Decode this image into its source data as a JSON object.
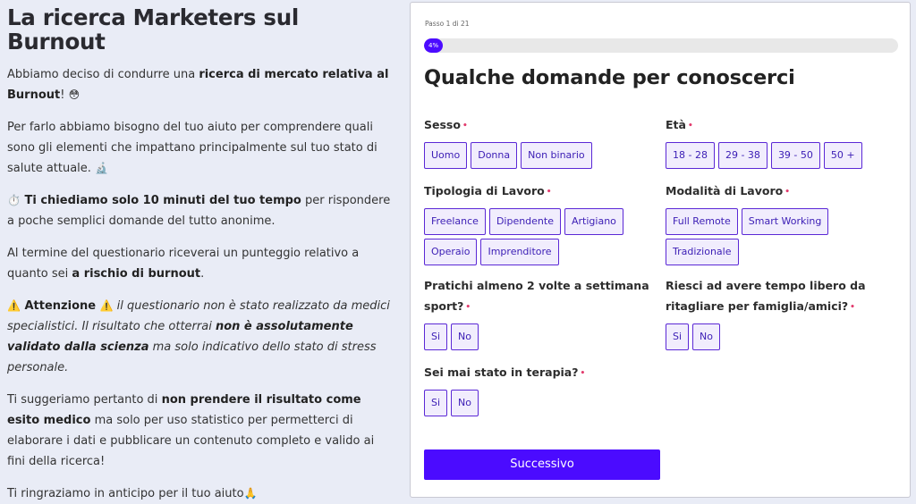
{
  "intro": {
    "title": "La ricerca Marketers sul Burnout",
    "p1": {
      "a": "Abbiamo deciso di condurre una ",
      "b": "ricerca di mercato relativa al Burnout",
      "c": "! ",
      "emoji": "😳"
    },
    "p2": {
      "a": "Per farlo abbiamo bisogno del tuo aiuto per comprendere quali sono gli elementi che impattano principalmente sul tuo stato di salute attuale. ",
      "emoji": "🔬"
    },
    "p3": {
      "emoji": "⏱️",
      "b": " Ti chiediamo solo 10 minuti del tuo tempo",
      "c": " per rispondere a poche semplici domande del tutto anonime."
    },
    "p4": {
      "a": "Al termine del questionario riceverai un punteggio relativo a quanto sei ",
      "b": "a rischio di burnout",
      "c": "."
    },
    "p5": {
      "emoji": "⚠️",
      "b": " Attenzione ",
      "emoji2": "⚠️",
      "i1": " il questionario non è stato realizzato da medici specialistici. Il risultato che otterrai ",
      "ib": "non è assolutamente validato dalla scienza",
      "i2": " ma solo indicativo dello stato di stress personale."
    },
    "p6": {
      "a": "Ti suggeriamo pertanto di ",
      "b": "non prendere il risultato come esito medico",
      "c": " ma solo per uso statistico per permetterci di elaborare i dati e pubblicare un contenuto completo e valido ai fini della ricerca!"
    },
    "p7": {
      "a": "Ti ringraziamo in anticipo per il tuo aiuto",
      "emoji": "🙏"
    }
  },
  "form": {
    "step": "Passo 1 di 21",
    "progress_label": "4%",
    "progress": 0.04,
    "title": "Qualche domande per conoscerci",
    "questions": [
      {
        "label": "Sesso",
        "required": "•",
        "options": [
          "Uomo",
          "Donna",
          "Non binario"
        ]
      },
      {
        "label": "Età",
        "required": "•",
        "options": [
          "18 - 28",
          "29 - 38",
          "39 - 50",
          "50 +"
        ]
      },
      {
        "label": "Tipologia di Lavoro",
        "required": "•",
        "options": [
          "Freelance",
          "Dipendente",
          "Artigiano",
          "Operaio",
          "Imprenditore"
        ]
      },
      {
        "label": "Modalità di Lavoro",
        "required": "•",
        "options": [
          "Full Remote",
          "Smart Working",
          "Tradizionale"
        ]
      },
      {
        "label": "Pratichi almeno 2 volte a settimana sport?",
        "required": "•",
        "options": [
          "Si",
          "No"
        ]
      },
      {
        "label": "Riesci ad avere tempo libero da ritagliare per famiglia/amici?",
        "required": "•",
        "options": [
          "Si",
          "No"
        ]
      },
      {
        "label": "Sei mai stato in terapia?",
        "required": "•",
        "options": [
          "Si",
          "No"
        ]
      }
    ],
    "submit_label": "Successivo"
  },
  "colors": {
    "accent": "#4b0bff",
    "option_border": "#5b28d6",
    "option_bg": "#f1edfd",
    "required": "#e23b6d"
  }
}
